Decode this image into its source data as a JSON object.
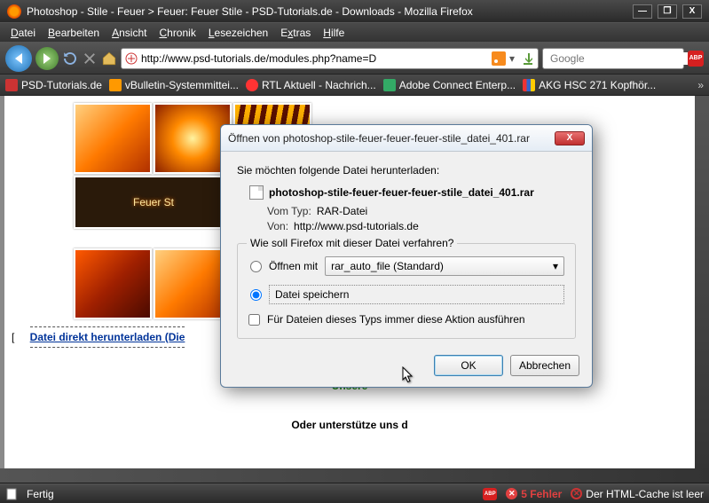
{
  "window": {
    "title": "Photoshop - Stile - Feuer > Feuer: Feuer Stile - PSD-Tutorials.de - Downloads - Mozilla Firefox",
    "controls": {
      "min": "—",
      "max": "❐",
      "close": "X"
    }
  },
  "menu": {
    "datei": "Datei",
    "bearbeiten": "Bearbeiten",
    "ansicht": "Ansicht",
    "chronik": "Chronik",
    "lesezeichen": "Lesezeichen",
    "extras": "Extras",
    "hilfe": "Hilfe"
  },
  "nav": {
    "url": "http://www.psd-tutorials.de/modules.php?name=D",
    "search_placeholder": "Google"
  },
  "bookmarks": [
    {
      "label": "PSD-Tutorials.de"
    },
    {
      "label": "vBulletin-Systemmittei..."
    },
    {
      "label": "RTL Aktuell - Nachrich..."
    },
    {
      "label": "Adobe Connect Enterp..."
    },
    {
      "label": "AKG HSC 271 Kopfhör..."
    }
  ],
  "page": {
    "feuer_title": "Feuer St",
    "download_link": "Datei direkt herunterladen (Die",
    "green": "Unsere",
    "support": "Oder unterstütze uns d"
  },
  "dialog": {
    "title": "Öffnen von photoshop-stile-feuer-feuer-feuer-stile_datei_401.rar",
    "intro": "Sie möchten folgende Datei herunterladen:",
    "filename": "photoshop-stile-feuer-feuer-feuer-stile_datei_401.rar",
    "type_k": "Vom Typ:",
    "type_v": "RAR-Datei",
    "from_k": "Von:",
    "from_v": "http://www.psd-tutorials.de",
    "legend": "Wie soll Firefox mit dieser Datei verfahren?",
    "open_with": "Öffnen mit",
    "combo": "rar_auto_file (Standard)",
    "save": "Datei speichern",
    "always": "Für Dateien dieses Typs immer diese Aktion ausführen",
    "ok": "OK",
    "cancel": "Abbrechen"
  },
  "status": {
    "ready": "Fertig",
    "abp": "ABP",
    "errors": "5 Fehler",
    "cache": "Der HTML-Cache ist leer"
  }
}
